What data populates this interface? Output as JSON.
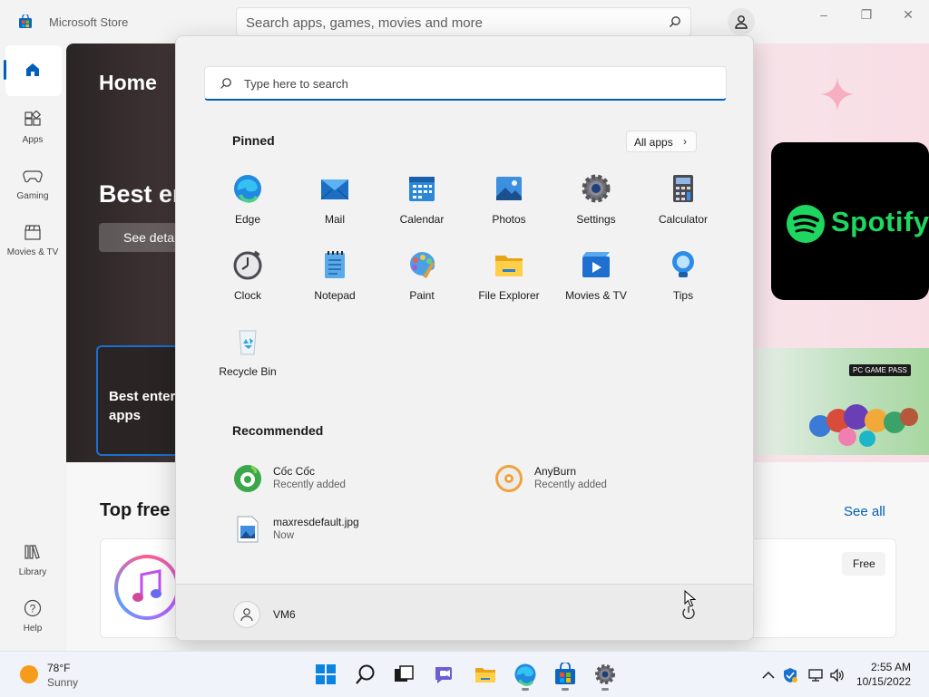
{
  "window": {
    "title": "Microsoft Store",
    "search_placeholder": "Search apps, games, movies and more",
    "controls": [
      "–",
      "❐",
      "✕"
    ]
  },
  "nav": {
    "home": "Home",
    "apps": "Apps",
    "gaming": "Gaming",
    "movies": "Movies & TV",
    "library": "Library",
    "help": "Help"
  },
  "store": {
    "page_title": "Home",
    "hero_title": "Best en",
    "hero_button": "See detai",
    "hero_card": "Best enter\napps",
    "spotify": "Spotify",
    "game_pass": "PC GAME PASS",
    "section_title": "Top free a",
    "see_all": "See all",
    "free_label": "Free"
  },
  "start_menu": {
    "search_placeholder": "Type here to search",
    "pinned_heading": "Pinned",
    "all_apps": "All apps",
    "pinned": [
      {
        "name": "Edge",
        "icon": "edge-icon"
      },
      {
        "name": "Mail",
        "icon": "mail-icon"
      },
      {
        "name": "Calendar",
        "icon": "calendar-icon"
      },
      {
        "name": "Photos",
        "icon": "photos-icon"
      },
      {
        "name": "Settings",
        "icon": "settings-icon"
      },
      {
        "name": "Calculator",
        "icon": "calculator-icon"
      },
      {
        "name": "Clock",
        "icon": "clock-icon"
      },
      {
        "name": "Notepad",
        "icon": "notepad-icon"
      },
      {
        "name": "Paint",
        "icon": "paint-icon"
      },
      {
        "name": "File Explorer",
        "icon": "file-explorer-icon"
      },
      {
        "name": "Movies & TV",
        "icon": "movies-tv-icon"
      },
      {
        "name": "Tips",
        "icon": "tips-icon"
      },
      {
        "name": "Recycle Bin",
        "icon": "recycle-bin-icon"
      }
    ],
    "recommended_heading": "Recommended",
    "recommended": [
      {
        "name": "Cốc Cốc",
        "sub": "Recently added",
        "icon": "coccoc-icon"
      },
      {
        "name": "AnyBurn",
        "sub": "Recently added",
        "icon": "anyburn-icon"
      },
      {
        "name": "maxresdefault.jpg",
        "sub": "Now",
        "icon": "image-file-icon"
      }
    ],
    "user": "VM6"
  },
  "taskbar": {
    "temperature": "78°F",
    "condition": "Sunny",
    "time": "2:55 AM",
    "date": "10/15/2022"
  },
  "colors": {
    "accent": "#005fb8",
    "spotify_green": "#1ed760"
  }
}
